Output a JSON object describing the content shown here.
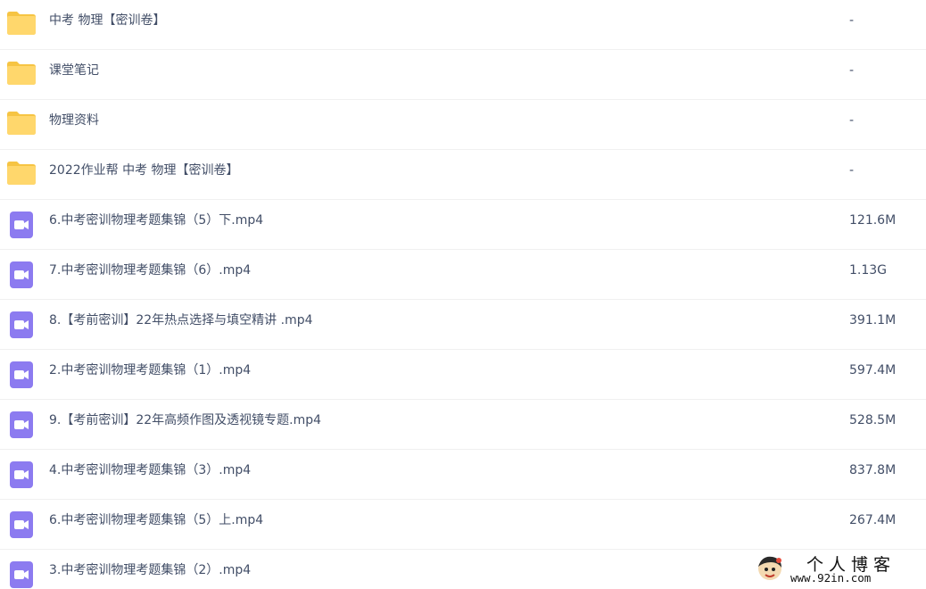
{
  "file_list": {
    "rows": [
      {
        "type": "folder",
        "icon": "folder-icon",
        "name": "中考 物理【密训卷】",
        "size": "-"
      },
      {
        "type": "folder",
        "icon": "folder-icon",
        "name": "课堂笔记",
        "size": "-"
      },
      {
        "type": "folder",
        "icon": "folder-icon",
        "name": "物理资料",
        "size": "-"
      },
      {
        "type": "folder",
        "icon": "folder-icon",
        "name": "2022作业帮 中考 物理【密训卷】",
        "size": "-"
      },
      {
        "type": "video",
        "icon": "video-file-icon",
        "name": "6.中考密训物理考题集锦（5）下.mp4",
        "size": "121.6M"
      },
      {
        "type": "video",
        "icon": "video-file-icon",
        "name": "7.中考密训物理考题集锦（6）.mp4",
        "size": "1.13G"
      },
      {
        "type": "video",
        "icon": "video-file-icon",
        "name": "8.【考前密训】22年热点选择与填空精讲 .mp4",
        "size": "391.1M"
      },
      {
        "type": "video",
        "icon": "video-file-icon",
        "name": "2.中考密训物理考题集锦（1）.mp4",
        "size": "597.4M"
      },
      {
        "type": "video",
        "icon": "video-file-icon",
        "name": "9.【考前密训】22年高频作图及透视镜专题.mp4",
        "size": "528.5M"
      },
      {
        "type": "video",
        "icon": "video-file-icon",
        "name": "4.中考密训物理考题集锦（3）.mp4",
        "size": "837.8M"
      },
      {
        "type": "video",
        "icon": "video-file-icon",
        "name": "6.中考密训物理考题集锦（5）上.mp4",
        "size": "267.4M"
      },
      {
        "type": "video",
        "icon": "video-file-icon",
        "name": "3.中考密训物理考题集锦（2）.mp4",
        "size": ""
      }
    ]
  },
  "colors": {
    "folder": "#ffd76c",
    "folder_tab": "#f6c443",
    "video": "#8c7bf0",
    "text": "#424e67",
    "divider": "#f0f0f0"
  },
  "watermark": {
    "title": "个人博客",
    "url": "www.92in.com"
  }
}
